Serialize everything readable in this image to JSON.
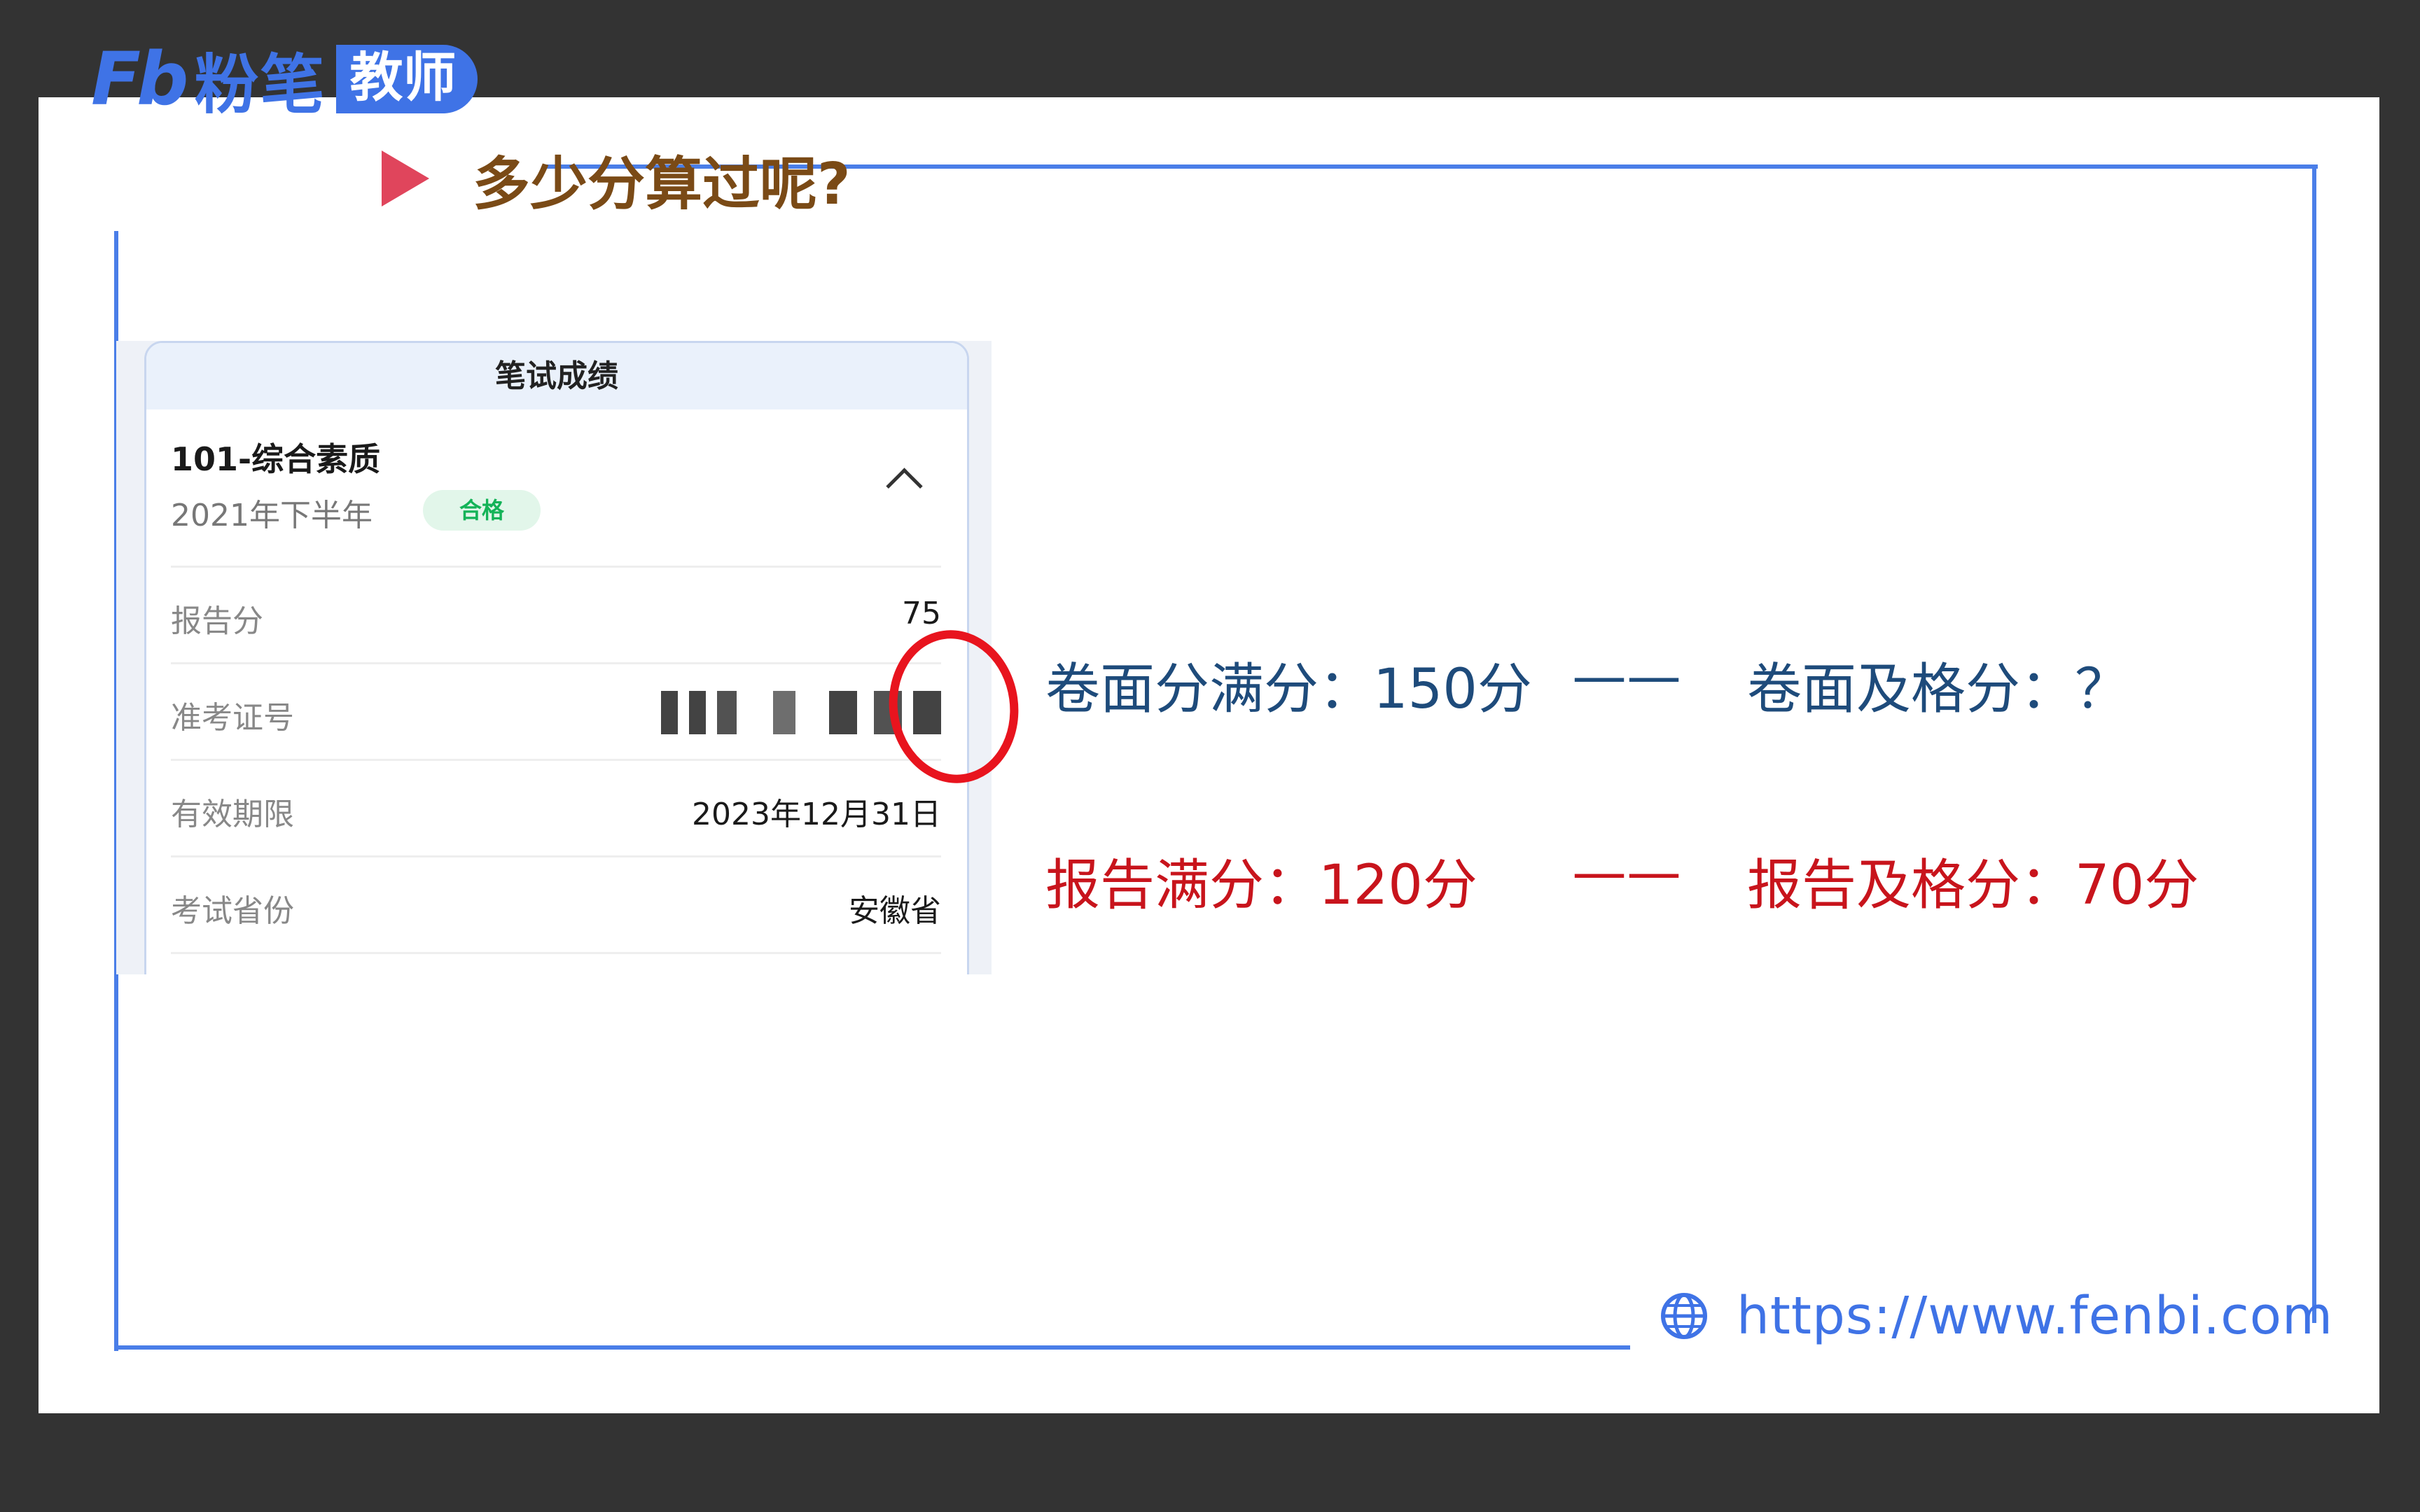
{
  "logo": {
    "mark": "Fb",
    "name": "粉笔",
    "tag": "教师"
  },
  "heading": "多少分算过呢?",
  "score_card": {
    "header": "笔试成绩",
    "subject": "101-综合素质",
    "term": "2021年下半年",
    "badge": "合格",
    "rows": [
      {
        "label": "报告分",
        "value": "75"
      },
      {
        "label": "准考证号",
        "value": ""
      },
      {
        "label": "有效期限",
        "value": "2023年12月31日"
      },
      {
        "label": "考试省份",
        "value": "安徽省"
      }
    ]
  },
  "info": {
    "paper_full": "卷面分满分：150分",
    "dash1": "——",
    "paper_pass": "卷面及格分：？",
    "report_full": "报告满分：120分",
    "dash2": "——",
    "report_pass": "报告及格分：70分"
  },
  "footer": {
    "url": "https://www.fenbi.com"
  },
  "colors": {
    "accent": "#3f73e6",
    "heading": "#7a4a16",
    "blue_text": "#1e4b7b",
    "red_text": "#c8141c"
  }
}
